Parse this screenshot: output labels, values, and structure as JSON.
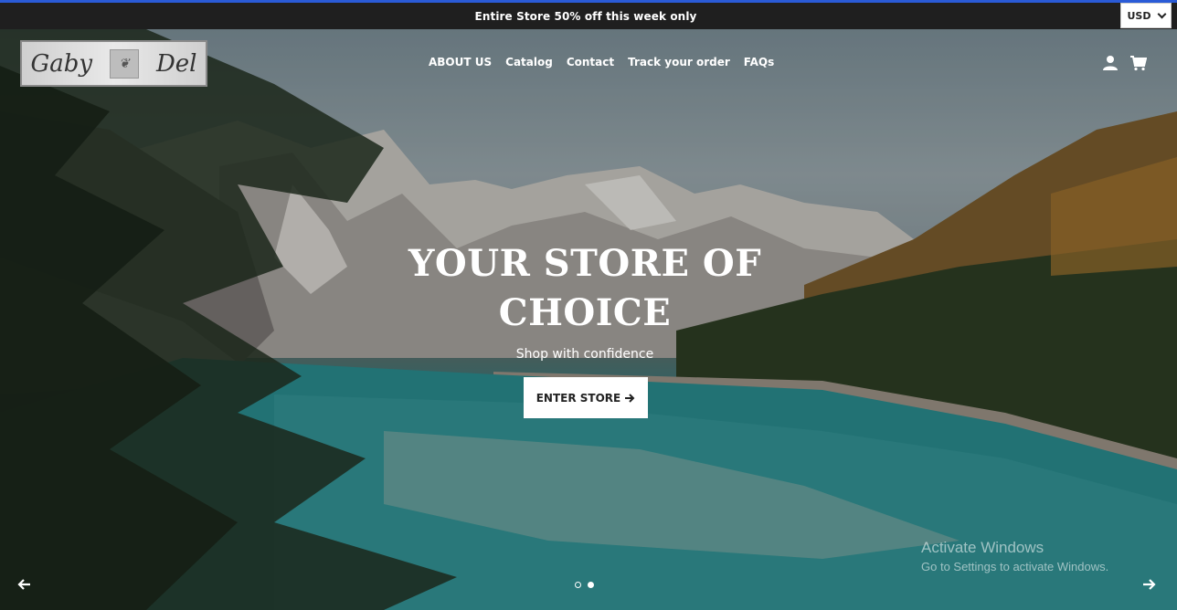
{
  "announcement": {
    "text": "Entire Store 50% off this week only"
  },
  "currency": {
    "value": "USD",
    "icon": "chevron-down-icon"
  },
  "brand": {
    "logo_text_left": "Gaby",
    "logo_text_right": "Del"
  },
  "nav": {
    "items": [
      {
        "label": "ABOUT US"
      },
      {
        "label": "Catalog"
      },
      {
        "label": "Contact"
      },
      {
        "label": "Track your order"
      },
      {
        "label": "FAQs"
      }
    ]
  },
  "header_icons": {
    "account": "user-icon",
    "cart": "cart-icon"
  },
  "hero": {
    "title": "YOUR STORE OF CHOICE",
    "subtitle": "Shop with confidence",
    "cta_label": "ENTER STORE",
    "slides_total": 2,
    "active_slide": 2
  },
  "watermark": {
    "line1": "Activate Windows",
    "line2": "Go to Settings to activate Windows."
  },
  "colors": {
    "announcement_bg": "#1f1f1f",
    "accent_line": "#2a5bd7",
    "cta_bg": "#ffffff"
  }
}
